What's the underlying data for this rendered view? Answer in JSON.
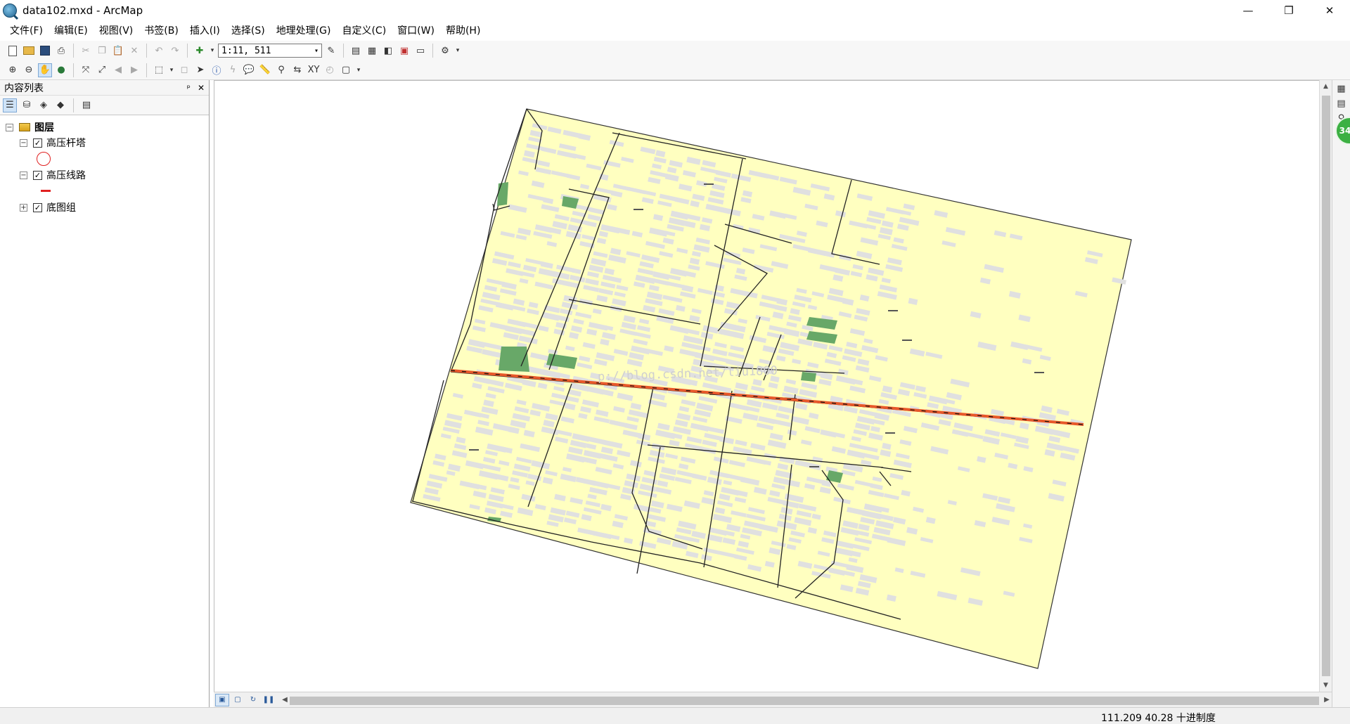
{
  "window": {
    "title": "data102.mxd - ArcMap",
    "minimize_glyph": "—",
    "restore_glyph": "❐",
    "close_glyph": "✕"
  },
  "menu": {
    "items": [
      "文件(F)",
      "编辑(E)",
      "视图(V)",
      "书签(B)",
      "插入(I)",
      "选择(S)",
      "地理处理(G)",
      "自定义(C)",
      "窗口(W)",
      "帮助(H)"
    ]
  },
  "toolbar": {
    "scale_value": "1:11, 511"
  },
  "toc": {
    "title": "内容列表",
    "pin_glyph": "ᵖ",
    "close_glyph": "✕",
    "root": {
      "label": "图层",
      "expanded": true
    },
    "layers": [
      {
        "label": "高压杆塔",
        "checked": true,
        "expanded": true,
        "symbol": "hollow-circle",
        "symbol_color": "#e02020"
      },
      {
        "label": "高压线路",
        "checked": true,
        "expanded": true,
        "symbol": "line",
        "symbol_color": "#e02020"
      },
      {
        "label": "底图组",
        "checked": true,
        "expanded": false
      }
    ]
  },
  "map": {
    "watermark": "p://blog.csdn.net/liu1800",
    "colors": {
      "land": "#ffffc0",
      "building": "#e0e0e0",
      "green": "#68a868",
      "road": "#222222",
      "power_line": "#e8582a"
    }
  },
  "right_dock": {
    "badge": "34"
  },
  "status": {
    "coordinates": "111.209  40.28 十进制度"
  }
}
